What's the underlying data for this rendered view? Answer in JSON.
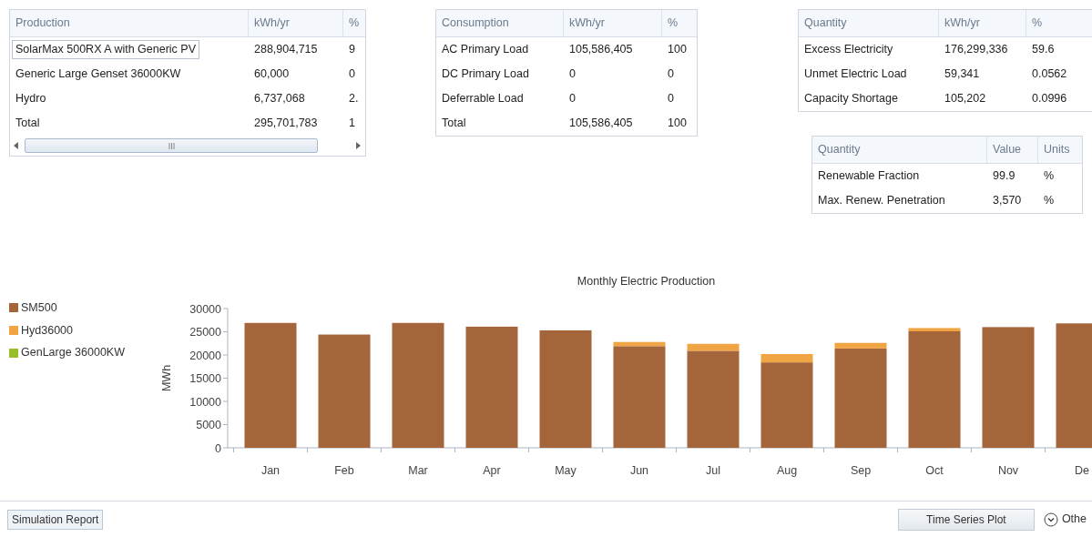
{
  "production_table": {
    "columns": [
      "Production",
      "kWh/yr",
      "%"
    ],
    "rows": [
      {
        "cells": [
          "SolarMax 500RX A with Generic PV",
          "288,904,715",
          "9"
        ],
        "selected": true
      },
      {
        "cells": [
          "Generic Large Genset 36000KW",
          "60,000",
          "0"
        ],
        "selected": false
      },
      {
        "cells": [
          "Hydro",
          "6,737,068",
          "2."
        ],
        "selected": false
      },
      {
        "cells": [
          "Total",
          "295,701,783",
          "1"
        ],
        "selected": false
      }
    ]
  },
  "consumption_table": {
    "columns": [
      "Consumption",
      "kWh/yr",
      "%"
    ],
    "rows": [
      [
        "AC Primary Load",
        "105,586,405",
        "100"
      ],
      [
        "DC Primary Load",
        "0",
        "0"
      ],
      [
        "Deferrable Load",
        "0",
        "0"
      ],
      [
        "Total",
        "105,586,405",
        "100"
      ]
    ]
  },
  "quantity_table": {
    "columns": [
      "Quantity",
      "kWh/yr",
      "%"
    ],
    "rows": [
      [
        "Excess Electricity",
        "176,299,336",
        "59.6"
      ],
      [
        "Unmet Electric Load",
        "59,341",
        "0.0562"
      ],
      [
        "Capacity Shortage",
        "105,202",
        "0.0996"
      ]
    ]
  },
  "renewable_table": {
    "columns": [
      "Quantity",
      "Value",
      "Units"
    ],
    "rows": [
      [
        "Renewable Fraction",
        "99.9",
        "%"
      ],
      [
        "Max. Renew. Penetration",
        "3,570",
        "%"
      ]
    ]
  },
  "chart": {
    "chart_data": {
      "type": "bar",
      "title": "Monthly Electric Production",
      "ylabel": "MWh",
      "stacked": true,
      "categories": [
        "Jan",
        "Feb",
        "Mar",
        "Apr",
        "May",
        "Jun",
        "Jul",
        "Aug",
        "Sep",
        "Oct",
        "Nov",
        "De"
      ],
      "series": [
        {
          "name": "SM500",
          "color": "#a5653a",
          "values": [
            26900,
            24400,
            26900,
            26100,
            25300,
            21900,
            20900,
            18400,
            21400,
            25100,
            26000,
            26800
          ]
        },
        {
          "name": "Hyd36000",
          "color": "#f0a443",
          "values": [
            0,
            0,
            0,
            0,
            0,
            900,
            1500,
            1800,
            1200,
            700,
            0,
            0
          ]
        },
        {
          "name": "GenLarge 36000KW",
          "color": "#98bf2a",
          "values": [
            0,
            0,
            0,
            0,
            0,
            0,
            0,
            0,
            0,
            0,
            0,
            0
          ]
        }
      ],
      "legend": true,
      "ylim": [
        0,
        30000
      ],
      "yticks": [
        0,
        5000,
        10000,
        15000,
        20000,
        25000,
        30000
      ]
    }
  },
  "footer": {
    "report_button": "Simulation Report",
    "plot_button": "Time Series Plot",
    "other_link": "Othe"
  }
}
